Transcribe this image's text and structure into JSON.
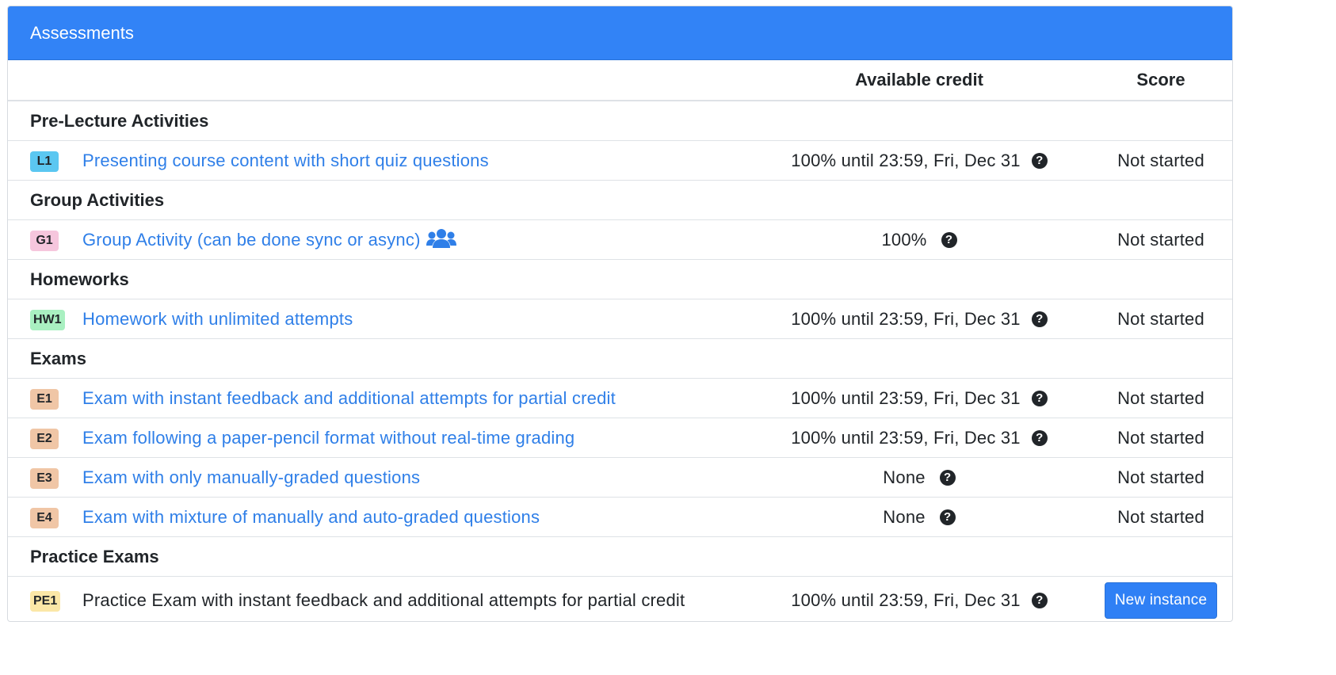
{
  "panel": {
    "title": "Assessments"
  },
  "columns": {
    "name": "",
    "credit": "Available credit",
    "score": "Score"
  },
  "colors": {
    "header_bg": "#3283f6",
    "link": "#2f7fe8",
    "badge_lecture": "#5bc7f1",
    "badge_group": "#f6c6dd",
    "badge_homework": "#a9f0c1",
    "badge_exam": "#f0c6a6",
    "badge_practice": "#fbe7a7",
    "button": "#2f80f5"
  },
  "sections": [
    {
      "heading": "Pre-Lecture Activities"
    },
    {
      "heading": "Group Activities"
    },
    {
      "heading": "Homeworks"
    },
    {
      "heading": "Exams"
    },
    {
      "heading": "Practice Exams"
    }
  ],
  "rows": [
    {
      "badge": "L1",
      "title": "Presenting course content with short quiz questions",
      "credit": "100% until 23:59, Fri, Dec 31",
      "score": "Not started",
      "help_icon": "question-circle-icon"
    },
    {
      "badge": "G1",
      "title": "Group Activity (can be done sync or async)",
      "credit": "100%",
      "score": "Not started",
      "help_icon": "question-circle-icon",
      "extra_icon": "users-icon"
    },
    {
      "badge": "HW1",
      "title": "Homework with unlimited attempts",
      "credit": "100% until 23:59, Fri, Dec 31",
      "score": "Not started",
      "help_icon": "question-circle-icon"
    },
    {
      "badge": "E1",
      "title": "Exam with instant feedback and additional attempts for partial credit",
      "credit": "100% until 23:59, Fri, Dec 31",
      "score": "Not started",
      "help_icon": "question-circle-icon"
    },
    {
      "badge": "E2",
      "title": "Exam following a paper-pencil format without real-time grading",
      "credit": "100% until 23:59, Fri, Dec 31",
      "score": "Not started",
      "help_icon": "question-circle-icon"
    },
    {
      "badge": "E3",
      "title": "Exam with only manually-graded questions",
      "credit": "None",
      "score": "Not started",
      "help_icon": "question-circle-icon"
    },
    {
      "badge": "E4",
      "title": "Exam with mixture of manually and auto-graded questions",
      "credit": "None",
      "score": "Not started",
      "help_icon": "question-circle-icon"
    },
    {
      "badge": "PE1",
      "title": "Practice Exam with instant feedback and additional attempts for partial credit",
      "credit": "100% until 23:59, Fri, Dec 31",
      "score_button": "New instance",
      "help_icon": "question-circle-icon"
    }
  ]
}
